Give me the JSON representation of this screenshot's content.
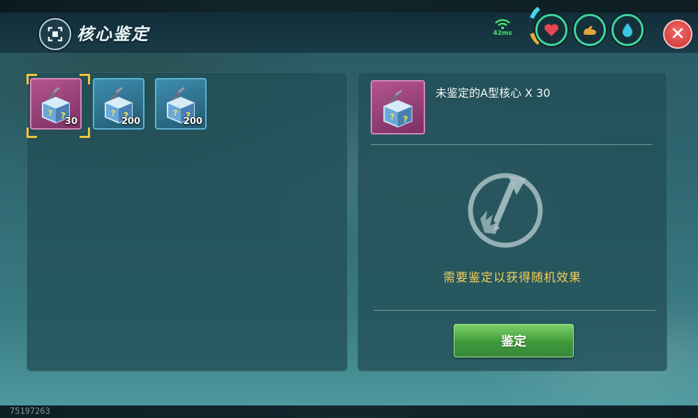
{
  "header": {
    "title": "核心鉴定",
    "ping": "42ms"
  },
  "stats": [
    {
      "icon": "heart-icon",
      "color": "#e8474f"
    },
    {
      "icon": "arm-strength-icon",
      "color": "#e0a53a"
    },
    {
      "icon": "water-drop-icon",
      "color": "#3ac6e0"
    }
  ],
  "inventory": [
    {
      "name": "未鉴定的A型核心",
      "count": "30",
      "rarity": "pink",
      "selected": true
    },
    {
      "name": "",
      "count": "200",
      "rarity": "blue",
      "selected": false
    },
    {
      "name": "",
      "count": "200",
      "rarity": "blue",
      "selected": false
    }
  ],
  "detail": {
    "item_label": "未鉴定的A型核心 X 30",
    "hint": "需要鉴定以获得随机效果",
    "action_label": "鉴定"
  },
  "footer": {
    "uid": "75197263"
  },
  "colors": {
    "accent_gold": "#f2cf5a",
    "button_green": "#4aa843",
    "close_red": "#d94141"
  }
}
